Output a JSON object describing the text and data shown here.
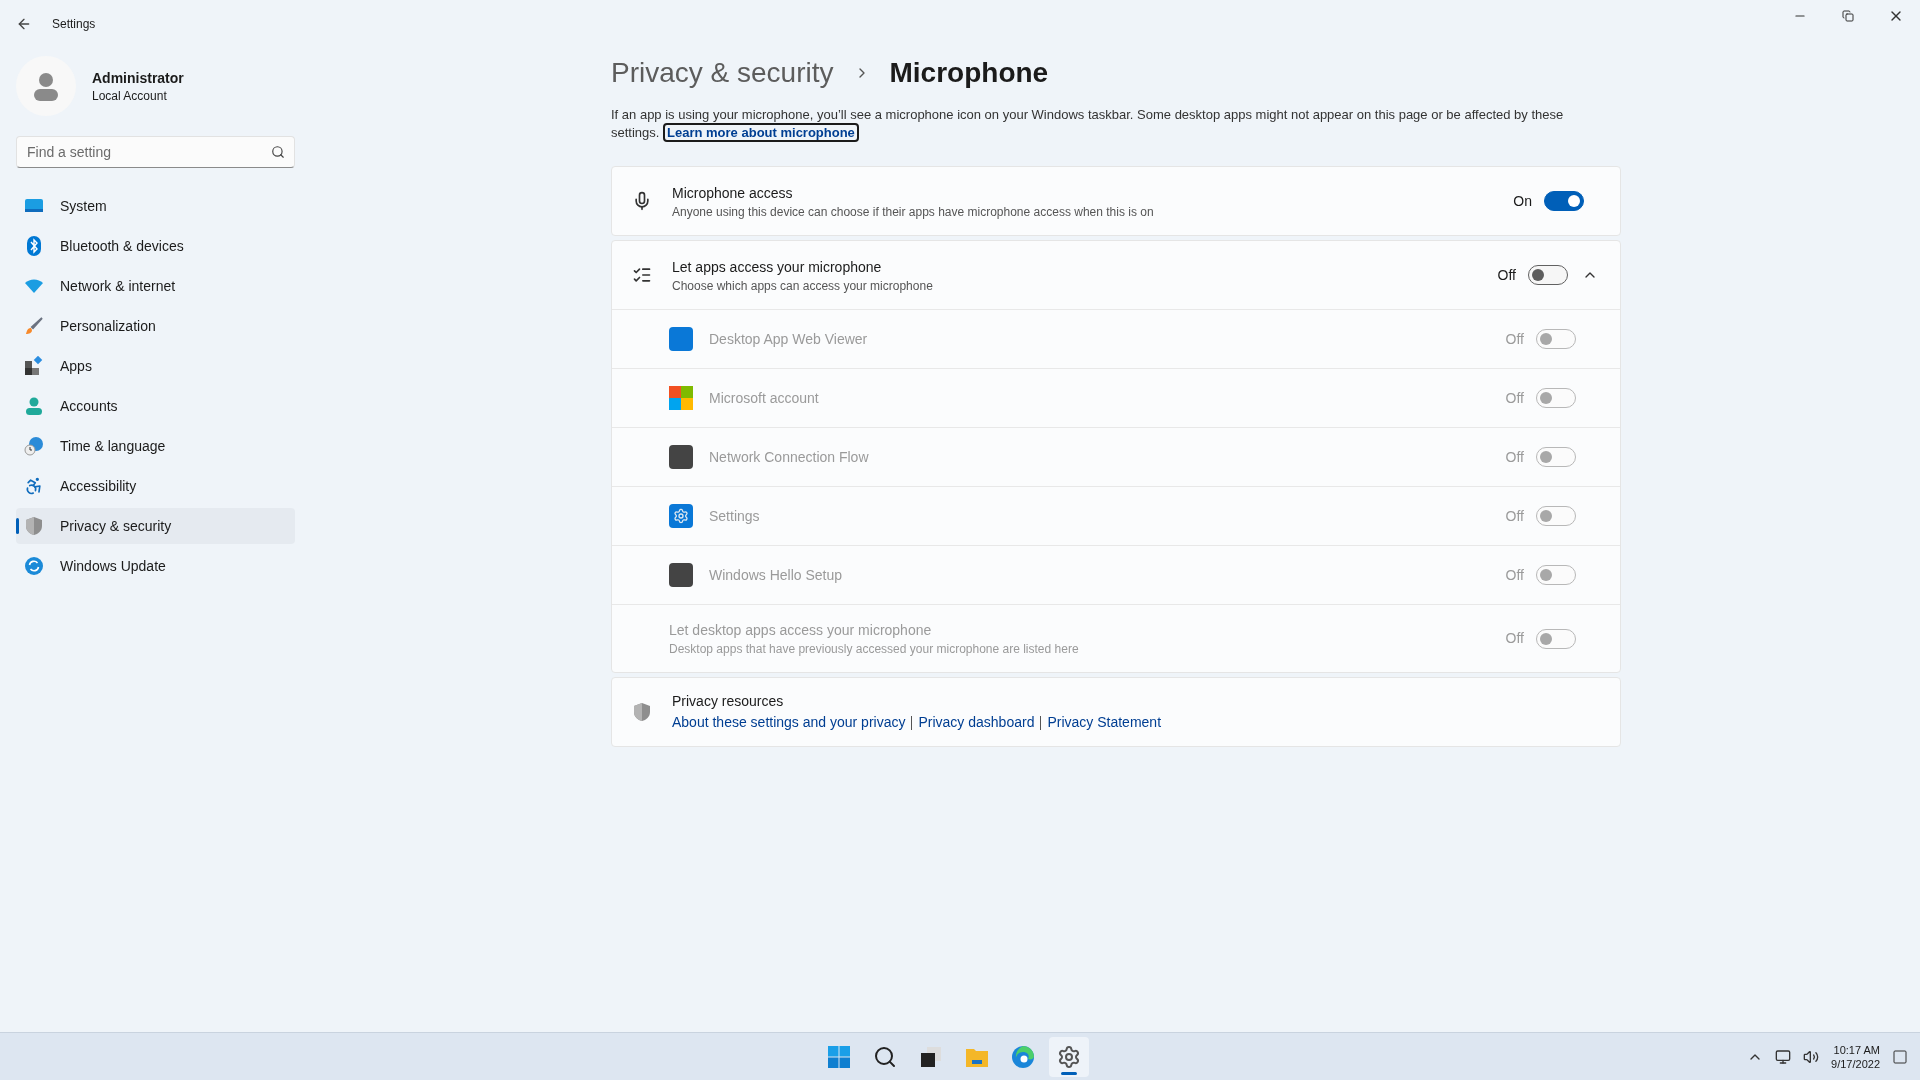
{
  "window": {
    "title": "Settings"
  },
  "user": {
    "name": "Administrator",
    "account": "Local Account"
  },
  "search": {
    "placeholder": "Find a setting"
  },
  "nav": [
    {
      "label": "System",
      "kind": "system",
      "selected": false
    },
    {
      "label": "Bluetooth & devices",
      "kind": "bluetooth",
      "selected": false
    },
    {
      "label": "Network & internet",
      "kind": "wifi",
      "selected": false
    },
    {
      "label": "Personalization",
      "kind": "brush",
      "selected": false
    },
    {
      "label": "Apps",
      "kind": "apps",
      "selected": false
    },
    {
      "label": "Accounts",
      "kind": "person",
      "selected": false
    },
    {
      "label": "Time & language",
      "kind": "globe",
      "selected": false
    },
    {
      "label": "Accessibility",
      "kind": "accessibility",
      "selected": false
    },
    {
      "label": "Privacy & security",
      "kind": "shield",
      "selected": true
    },
    {
      "label": "Windows Update",
      "kind": "update",
      "selected": false
    }
  ],
  "breadcrumb": {
    "parent": "Privacy & security",
    "current": "Microphone"
  },
  "intro": {
    "text": "If an app is using your microphone, you’ll see a microphone icon on your Windows taskbar. Some desktop apps might not appear on this page or be affected by these settings.",
    "link": "Learn more about microphone"
  },
  "microphone_access": {
    "title": "Microphone access",
    "subtitle": "Anyone using this device can choose if their apps have microphone access when this is on",
    "state_label": "On",
    "on": true
  },
  "app_access": {
    "title": "Let apps access your microphone",
    "subtitle": "Choose which apps can access your microphone",
    "state_label": "Off",
    "on": false,
    "expanded": true,
    "apps": [
      {
        "name": "Desktop App Web Viewer",
        "kind": "blue",
        "state_label": "Off",
        "on": false,
        "disabled": true
      },
      {
        "name": "Microsoft account",
        "kind": "logo",
        "state_label": "Off",
        "on": false,
        "disabled": true
      },
      {
        "name": "Network Connection Flow",
        "kind": "dark",
        "state_label": "Off",
        "on": false,
        "disabled": true
      },
      {
        "name": "Settings",
        "kind": "gear",
        "state_label": "Off",
        "on": false,
        "disabled": true
      },
      {
        "name": "Windows Hello Setup",
        "kind": "dark",
        "state_label": "Off",
        "on": false,
        "disabled": true
      }
    ],
    "desktop": {
      "title": "Let desktop apps access your microphone",
      "subtitle": "Desktop apps that have previously accessed your microphone are listed here",
      "state_label": "Off",
      "on": false,
      "disabled": true
    }
  },
  "privacy_resources": {
    "title": "Privacy resources",
    "links": [
      "About these settings and your privacy",
      "Privacy dashboard",
      "Privacy Statement"
    ]
  },
  "taskbar": {
    "apps": [
      {
        "kind": "start",
        "selected": false
      },
      {
        "kind": "search",
        "selected": false
      },
      {
        "kind": "taskview",
        "selected": false
      },
      {
        "kind": "folder",
        "selected": false
      },
      {
        "kind": "edge",
        "selected": false
      },
      {
        "kind": "settings",
        "selected": true
      }
    ],
    "time": "10:17 AM",
    "date": "9/17/2022"
  }
}
